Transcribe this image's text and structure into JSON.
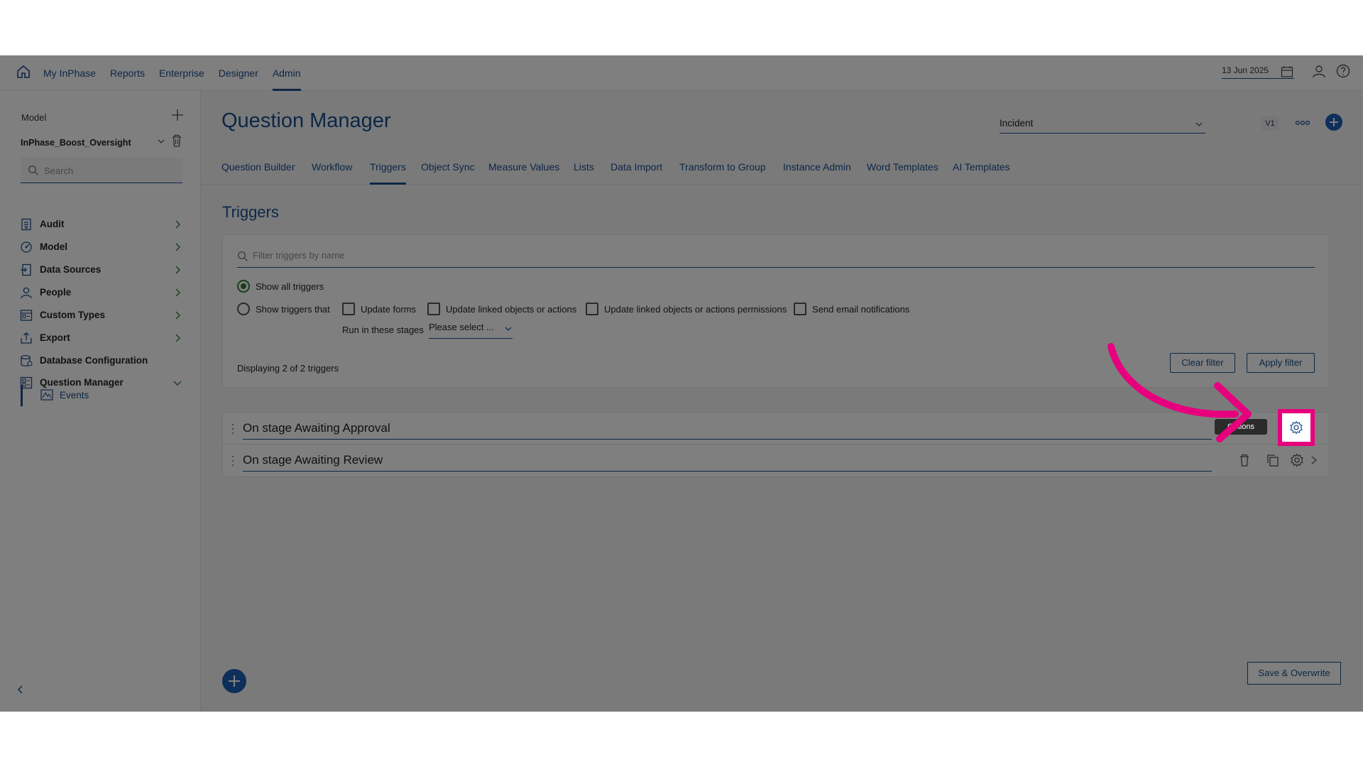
{
  "topnav": {
    "items": [
      {
        "label": "My InPhase",
        "active": false
      },
      {
        "label": "Reports",
        "active": false
      },
      {
        "label": "Enterprise",
        "active": false
      },
      {
        "label": "Designer",
        "active": false
      },
      {
        "label": "Admin",
        "active": true
      }
    ],
    "date": "13 Jun 2025"
  },
  "sidebar": {
    "model_label": "Model",
    "model_name": "InPhase_Boost_Oversight",
    "search_placeholder": "Search",
    "items": [
      {
        "label": "Audit",
        "icon": "audit-icon"
      },
      {
        "label": "Model",
        "icon": "model-icon"
      },
      {
        "label": "Data Sources",
        "icon": "data-sources-icon"
      },
      {
        "label": "People",
        "icon": "person-icon"
      },
      {
        "label": "Custom Types",
        "icon": "custom-types-icon"
      },
      {
        "label": "Export",
        "icon": "export-icon"
      },
      {
        "label": "Database Configuration",
        "icon": "database-icon"
      },
      {
        "label": "Question Manager",
        "icon": "question-manager-icon"
      }
    ],
    "sub_item": {
      "label": "Events",
      "icon": "events-icon"
    }
  },
  "header": {
    "title": "Question Manager",
    "form_select": "Incident",
    "version": "V1"
  },
  "tabs": [
    {
      "label": "Question Builder",
      "active": false
    },
    {
      "label": "Workflow",
      "active": false
    },
    {
      "label": "Triggers",
      "active": true
    },
    {
      "label": "Object Sync",
      "active": false
    },
    {
      "label": "Measure Values",
      "active": false
    },
    {
      "label": "Lists",
      "active": false
    },
    {
      "label": "Data Import",
      "active": false
    },
    {
      "label": "Transform to Group",
      "active": false
    },
    {
      "label": "Instance Admin",
      "active": false
    },
    {
      "label": "Word Templates",
      "active": false
    },
    {
      "label": "AI Templates",
      "active": false
    }
  ],
  "triggers": {
    "section_title": "Triggers",
    "filter_placeholder": "Filter triggers by name",
    "radio_all": "Show all triggers",
    "radio_that": "Show triggers that",
    "checkboxes": [
      "Update forms",
      "Update linked objects or actions",
      "Update linked objects or actions permissions",
      "Send email notifications"
    ],
    "stages_label": "Run in these stages",
    "stages_placeholder": "Please select ...",
    "display_count": "Displaying 2 of 2 triggers",
    "clear_filter": "Clear filter",
    "apply_filter": "Apply filter",
    "list": [
      {
        "name": "On stage Awaiting Approval"
      },
      {
        "name": "On stage Awaiting Review"
      }
    ],
    "tooltip": "Options",
    "save_button": "Save & Overwrite"
  },
  "colors": {
    "brand": "#1a4f8b",
    "highlight": "#e6007e",
    "radio_selected": "#2e7d32"
  }
}
